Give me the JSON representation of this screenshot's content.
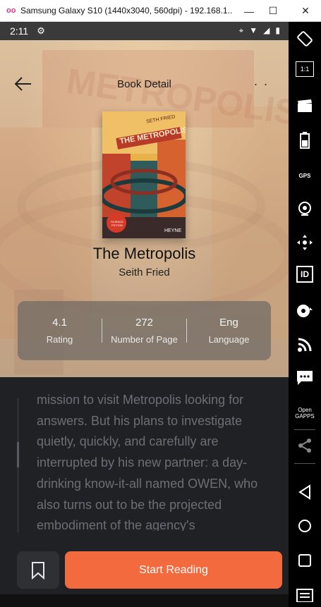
{
  "window": {
    "title": "Samsung Galaxy S10 (1440x3040, 560dpi) - 192.168.1...",
    "app_icon": "oo",
    "minimize": "—",
    "maximize": "☐",
    "close": "✕"
  },
  "status_bar": {
    "time": "2:11",
    "settings_icon": "gear-icon"
  },
  "header": {
    "title": "Book Detail",
    "back_icon": "arrow-left-icon",
    "more_icon": ". ."
  },
  "book": {
    "title": "The Metropolis",
    "author": "Seith Fried",
    "cover_text": "THE METROPOLIST",
    "cover_author": "SETH FRIED",
    "cover_publisher": "HEYNE",
    "cover_badge": "SCIENCE FICTION"
  },
  "stats": [
    {
      "value": "4.1",
      "label": "Rating"
    },
    {
      "value": "272",
      "label": "Number of Page"
    },
    {
      "value": "Eng",
      "label": "Language"
    }
  ],
  "description": "mission to visit Metropolis looking for answers. But his plans to investigate quietly, quickly, and carefully are interrupted by his new partner: a day-drinking know-it-all named OWEN, who also turns out to be the projected embodiment of the agency's",
  "actions": {
    "start_reading": "Start Reading",
    "bookmark_icon": "bookmark-icon"
  },
  "sidebar_tools": [
    "rotate-icon",
    "1:1",
    "clapperboard-icon",
    "battery-icon",
    "GPS",
    "webcam-icon",
    "dpad-icon",
    "ID",
    "disk-icon",
    "rss-icon",
    "chat-icon",
    "Open GAPPS",
    "share-icon",
    "back-icon",
    "home-icon",
    "recents-icon",
    "menu-icon"
  ],
  "colors": {
    "accent": "#f26a3d",
    "background": "#202125",
    "stats_panel": "#6e6964"
  }
}
